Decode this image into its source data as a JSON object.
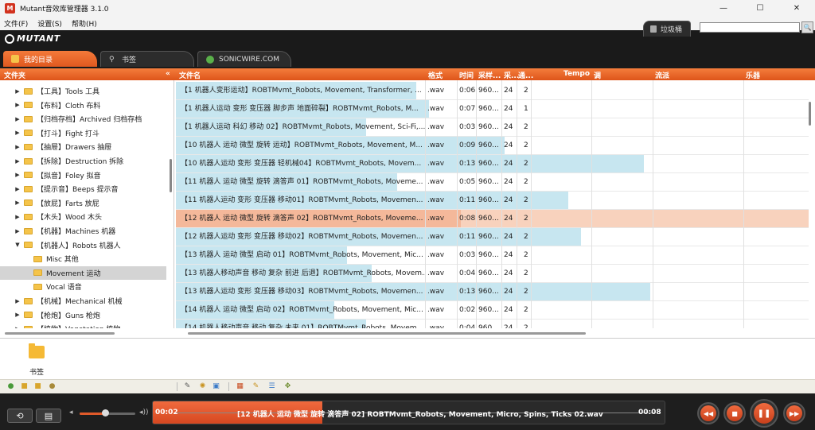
{
  "window": {
    "title": "Mutant音效库管理器 3.1.0",
    "minimize": "—",
    "maximize": "☐",
    "close": "✕"
  },
  "menu": [
    "文件(F)",
    "设置(S)",
    "帮助(H)"
  ],
  "header": {
    "logo": "MUTANT",
    "tabs": [
      {
        "label": "我的目录",
        "icon": "box-icon"
      },
      {
        "label": "书签",
        "icon": "link-icon"
      },
      {
        "label": "SONICWIRE.COM",
        "icon": "globe-icon"
      }
    ],
    "trash": "垃圾桶",
    "search_placeholder": "",
    "search_icon": "🔍"
  },
  "columns": {
    "folder": "文件夹",
    "collapse": "«",
    "name": "文件名",
    "format": "格式",
    "time": "时间",
    "samplerate": "采样...",
    "bits": "采...",
    "channels": "通...",
    "tempo": "Tempo",
    "key": "调",
    "genre": "流派",
    "instrument": "乐器"
  },
  "tree": [
    {
      "label": "【工具】Tools 工具",
      "arrow": "▶",
      "indent": 0
    },
    {
      "label": "【布料】Cloth 布料",
      "arrow": "▶",
      "indent": 0
    },
    {
      "label": "【归档存档】Archived 归档存档",
      "arrow": "▶",
      "indent": 0
    },
    {
      "label": "【打斗】Fight 打斗",
      "arrow": "▶",
      "indent": 0
    },
    {
      "label": "【抽屉】Drawers 抽屉",
      "arrow": "▶",
      "indent": 0
    },
    {
      "label": "【拆除】Destruction 拆除",
      "arrow": "▶",
      "indent": 0
    },
    {
      "label": "【拟音】Foley 拟音",
      "arrow": "▶",
      "indent": 0
    },
    {
      "label": "【提示音】Beeps 提示音",
      "arrow": "▶",
      "indent": 0
    },
    {
      "label": "【放屁】Farts 放屁",
      "arrow": "▶",
      "indent": 0
    },
    {
      "label": "【木头】Wood 木头",
      "arrow": "▶",
      "indent": 0
    },
    {
      "label": "【机器】Machines 机器",
      "arrow": "▶",
      "indent": 0
    },
    {
      "label": "【机器人】Robots 机器人",
      "arrow": "▼",
      "indent": 0
    },
    {
      "label": "Misc 其他",
      "arrow": "",
      "indent": 1
    },
    {
      "label": "Movement 运动",
      "arrow": "",
      "indent": 1,
      "selected": true
    },
    {
      "label": "Vocal 语音",
      "arrow": "",
      "indent": 1
    },
    {
      "label": "【机械】Mechanical 机械",
      "arrow": "▶",
      "indent": 0
    },
    {
      "label": "【枪炮】Guns 枪炮",
      "arrow": "▶",
      "indent": 0
    },
    {
      "label": "【植物】Vegetation 植物",
      "arrow": "▶",
      "indent": 0
    }
  ],
  "files": [
    {
      "name": "【1 机器人变形运动】ROBTMvmt_Robots, Movement, Transformer, ...",
      "format": ".wav",
      "time": "0:06",
      "sr": "960...",
      "bits": "24",
      "ch": "2",
      "level": 0.38
    },
    {
      "name": "【1 机器人运动 变形 变压器 脚步声 地面碎裂】ROBTMvmt_Robots, M...",
      "format": ".wav",
      "time": "0:07",
      "sr": "960...",
      "bits": "24",
      "ch": "1",
      "level": 0.4
    },
    {
      "name": "【1 机器人运动 科幻 移动 02】ROBTMvmt_Robots, Movement, Sci-Fi,...",
      "format": ".wav",
      "time": "0:03",
      "sr": "960...",
      "bits": "24",
      "ch": "2",
      "level": 0.3
    },
    {
      "name": "【10 机器人 运动 微型 旋转 运动】ROBTMvmt_Robots, Movement, M...",
      "format": ".wav",
      "time": "0:09",
      "sr": "960...",
      "bits": "24",
      "ch": "2",
      "level": 0.52
    },
    {
      "name": "【10 机器人运动 变形 变压器 轻机械04】ROBTMvmt_Robots, Movem...",
      "format": ".wav",
      "time": "0:13",
      "sr": "960...",
      "bits": "24",
      "ch": "2",
      "level": 0.74
    },
    {
      "name": "【11 机器人 运动 微型 旋转 滴答声 01】ROBTMvmt_Robots, Moveme...",
      "format": ".wav",
      "time": "0:05",
      "sr": "960...",
      "bits": "24",
      "ch": "2",
      "level": 0.35
    },
    {
      "name": "【11 机器人运动 变形 变压器 移动01】ROBTMvmt_Robots, Movemen...",
      "format": ".wav",
      "time": "0:11",
      "sr": "960...",
      "bits": "24",
      "ch": "2",
      "level": 0.62
    },
    {
      "name": "【12 机器人 运动 微型 旋转 滴答声 02】ROBTMvmt_Robots, Moveme...",
      "format": ".wav",
      "time": "0:08",
      "sr": "960...",
      "bits": "24",
      "ch": "2",
      "level": 0.45,
      "highlight": true
    },
    {
      "name": "【12 机器人运动 变形 变压器 移动02】ROBTMvmt_Robots, Movemen...",
      "format": ".wav",
      "time": "0:11",
      "sr": "960...",
      "bits": "24",
      "ch": "2",
      "level": 0.64
    },
    {
      "name": "【13 机器人 运动 微型 启动 01】ROBTMvmt_Robots, Movement, Mic...",
      "format": ".wav",
      "time": "0:03",
      "sr": "960...",
      "bits": "24",
      "ch": "2",
      "level": 0.27
    },
    {
      "name": "【13 机器人移动声音 移动 复杂 前进 后退】ROBTMvmt_Robots, Movem...",
      "format": ".wav",
      "time": "0:04",
      "sr": "960...",
      "bits": "24",
      "ch": "2",
      "level": 0.31
    },
    {
      "name": "【13 机器人运动 变形 变压器 移动03】ROBTMvmt_Robots, Movemen...",
      "format": ".wav",
      "time": "0:13",
      "sr": "960...",
      "bits": "24",
      "ch": "2",
      "level": 0.75
    },
    {
      "name": "【14 机器人 运动 微型 启动 02】ROBTMvmt_Robots, Movement, Mic...",
      "format": ".wav",
      "time": "0:02",
      "sr": "960...",
      "bits": "24",
      "ch": "2",
      "level": 0.25
    },
    {
      "name": "【14 机器人移动声音 移动 复杂 未来 01】ROBTMvmt_Robots, Movem...",
      "format": ".wav",
      "time": "0:04",
      "sr": "960...",
      "bits": "24",
      "ch": "2",
      "level": 0.3
    }
  ],
  "bookmarks": {
    "label": "书签"
  },
  "player": {
    "time_elapsed": "00:02",
    "time_total": "00:08",
    "now_playing": "[12 机器人 运动 微型 旋转 滴答声 02] ROBTMvmt_Robots, Movement, Micro, Spins, Ticks 02.wav",
    "progress": 0.33,
    "volume": 0.45,
    "loop_icon": "⟲",
    "list_icon": "▤",
    "prev_icon": "◀◀",
    "stop_icon": "■",
    "pause_icon": "❚❚",
    "next_icon": "▶▶"
  }
}
